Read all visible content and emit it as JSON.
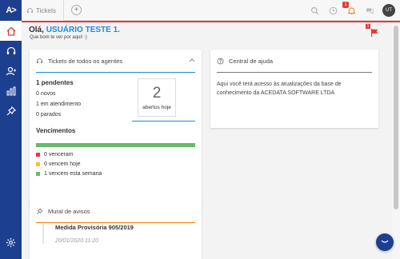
{
  "sidebar": {
    "logo": "A>",
    "items": [
      {
        "name": "home"
      },
      {
        "name": "headset"
      },
      {
        "name": "contacts"
      },
      {
        "name": "reports"
      },
      {
        "name": "pin"
      }
    ]
  },
  "topbar": {
    "tab_label": "Tickets",
    "add_label": "+",
    "notif_badge_1": "1",
    "notif_badge_2": "1",
    "avatar_text": "UT"
  },
  "main": {
    "greet_prefix": "Olá,",
    "greet_user": "USUÁRIO TESTE 1.",
    "greet_sub": "Que bom te ver por aqui! :)",
    "flag_badge": "1"
  },
  "tickets_card": {
    "title": "Tickets de todos os agentes",
    "pending": "1 pendentes",
    "novos": "0 novos",
    "atendimento": "1 em atendimento",
    "parados": "0 parados",
    "kpi_value": "2",
    "kpi_label": "abertos hoje",
    "venc_title": "Vencimentos",
    "venc_items": [
      {
        "label": "0 venceram",
        "color": "#e53935"
      },
      {
        "label": "0 vencem hoje",
        "color": "#fbc02d"
      },
      {
        "label": "1 vencem esta semana",
        "color": "#66bb6a"
      }
    ]
  },
  "help_card": {
    "title": "Central de ajuda",
    "text": "Aqui você terá acesso às atualizações da base de conhecimento da ACEDATA SOFTWARE LTDA"
  },
  "mural_card": {
    "title": "Mural de avisos",
    "item_title": "Medida Provisória 905/2019",
    "item_date": "20/01/2020 11:20"
  },
  "colors": {
    "primary": "#1d3f8f",
    "accent": "#1e88e5",
    "red": "#e53935",
    "orange": "#f57c00",
    "green": "#66bb6a"
  }
}
